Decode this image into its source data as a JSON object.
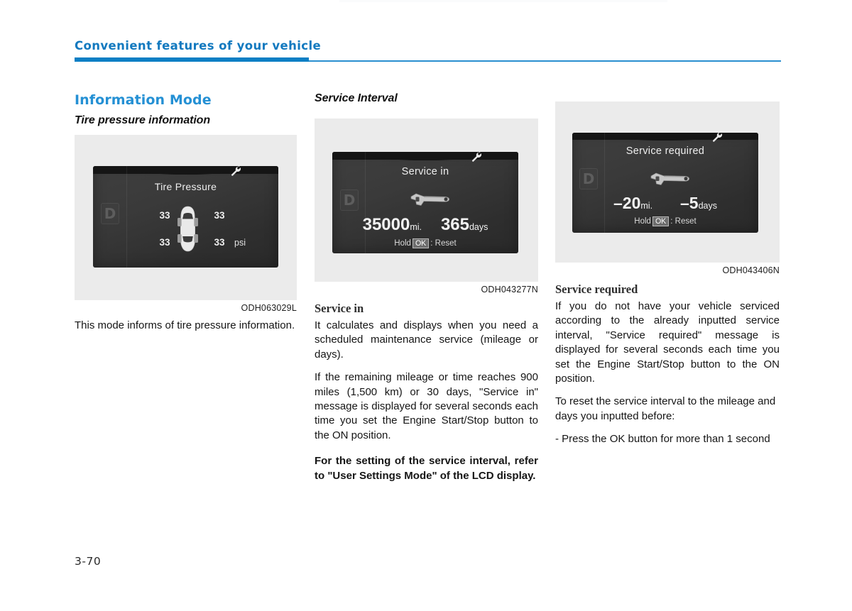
{
  "page": {
    "header_title": "Convenient features of your vehicle",
    "page_number": "3-70"
  },
  "column_1": {
    "heading_blue": "Information Mode",
    "heading_italic": "Tire pressure information",
    "figure": {
      "code": "ODH063029L",
      "lcd": {
        "gear": "D",
        "title": "Tire Pressure",
        "front_left": "33",
        "front_right": "33",
        "rear_left": "33",
        "rear_right": "33",
        "unit": "psi",
        "top_icon": "wrench-icon",
        "car_icon": "car-top-view-icon"
      }
    },
    "body": "This mode informs of tire pressure information."
  },
  "column_2": {
    "heading_italic": "Service Interval",
    "figure": {
      "code": "ODH043277N",
      "lcd": {
        "gear": "D",
        "title": "Service in",
        "wrench_icon": "adjustable-wrench-icon",
        "mileage_value": "35000",
        "mileage_unit": "mi.",
        "days_value": "365",
        "days_unit": "days",
        "hold_prefix": "Hold",
        "ok_key": "OK",
        "hold_suffix": ": Reset",
        "top_icon": "wrench-icon"
      }
    },
    "heading_serif": "Service in",
    "paragraph_1": "It calculates and displays when you need a scheduled maintenance service (mileage or days).",
    "paragraph_2": "If the remaining mileage or time reaches 900 miles (1,500 km) or 30 days, \"Service in\" message is displayed for several seconds each time you set the Engine Start/Stop button to the ON position.",
    "paragraph_3_bold": "For the setting of the service interval, refer to \"User Settings Mode\" of the LCD display."
  },
  "column_3": {
    "figure": {
      "code": "ODH043406N",
      "lcd": {
        "gear": "D",
        "title": "Service required",
        "wrench_icon": "adjustable-wrench-icon",
        "mileage_value": "–20",
        "mileage_unit": "mi.",
        "days_value": "–5",
        "days_unit": "days",
        "hold_prefix": "Hold",
        "ok_key": "OK",
        "hold_suffix": ": Reset",
        "top_icon": "wrench-icon"
      }
    },
    "heading_serif": "Service required",
    "paragraph_1": "If you do not have your vehicle serviced according to the already inputted service interval, \"Service required\" message is displayed for several seconds each time you set the Engine Start/Stop button to the ON position.",
    "paragraph_2": "To reset the service interval to the mileage and days you inputted before:",
    "paragraph_3": "- Press the OK button for more than 1 second"
  }
}
